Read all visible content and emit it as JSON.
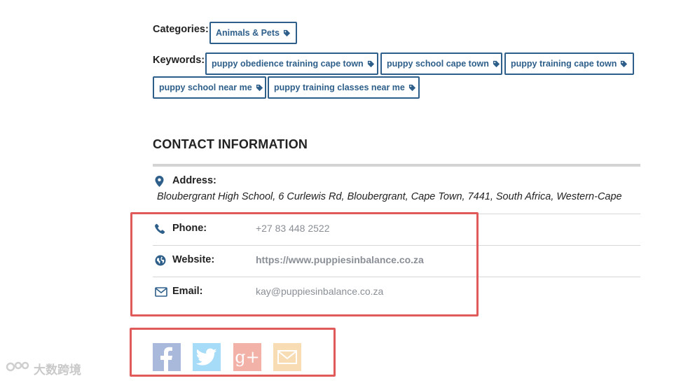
{
  "categories": {
    "label": "Categories:",
    "items": [
      {
        "label": "Animals & Pets",
        "icon": "tag-icon"
      }
    ]
  },
  "keywords": {
    "label": "Keywords:",
    "items": [
      {
        "label": "puppy obedience training cape town",
        "icon": "tag-icon"
      },
      {
        "label": "puppy school cape town",
        "icon": "tag-icon"
      },
      {
        "label": "puppy training cape town",
        "icon": "tag-icon"
      },
      {
        "label": "puppy school near me",
        "icon": "tag-icon"
      },
      {
        "label": "puppy training classes near me",
        "icon": "tag-icon"
      }
    ]
  },
  "contact": {
    "title": "CONTACT INFORMATION",
    "address": {
      "label": "Address:",
      "value": "Bloubergrant High School, 6 Curlewis Rd, Bloubergrant, Cape Town, 7441, South Africa, Western-Cape",
      "icon": "map-pin-icon"
    },
    "phone": {
      "label": "Phone:",
      "value": "+27 83 448 2522",
      "icon": "phone-icon"
    },
    "website": {
      "label": "Website:",
      "value": "https://www.puppiesinbalance.co.za",
      "icon": "globe-icon"
    },
    "email": {
      "label": "Email:",
      "value": "kay@puppiesinbalance.co.za",
      "icon": "envelope-icon"
    }
  },
  "social": [
    {
      "name": "facebook",
      "icon": "facebook-icon",
      "color": "#3b5998",
      "glyph": "f"
    },
    {
      "name": "twitter",
      "icon": "twitter-icon",
      "color": "#1da1f2",
      "glyph": ""
    },
    {
      "name": "google-plus",
      "icon": "google-plus-icon",
      "color": "#dd4b39",
      "glyph": "g+"
    },
    {
      "name": "email",
      "icon": "email-share-icon",
      "color": "#f0a94a",
      "glyph": ""
    }
  ],
  "colors": {
    "accent": "#2e5f8a",
    "highlight_box": "#e05a5a",
    "muted_text": "#8a8f96"
  },
  "watermark": {
    "text": "大数跨境",
    "icon": "watermark-logo-icon"
  }
}
